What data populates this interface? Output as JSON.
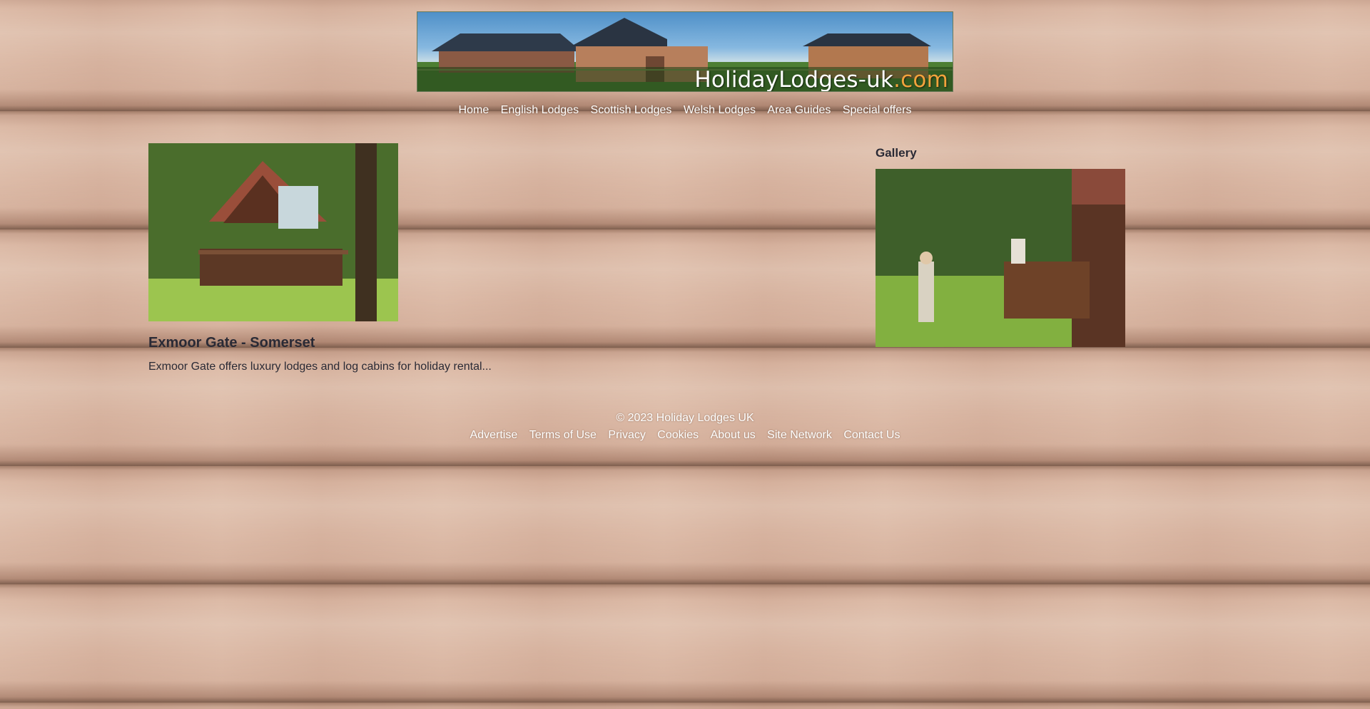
{
  "header": {
    "logo_text": "HolidayLodges-uk",
    "logo_tld": ".com"
  },
  "nav": {
    "items": [
      "Home",
      "English Lodges",
      "Scottish Lodges",
      "Welsh Lodges",
      "Area Guides",
      "Special offers"
    ]
  },
  "article": {
    "title": "Exmoor Gate - Somerset",
    "summary": "Exmoor Gate offers luxury lodges and log cabins for holiday rental..."
  },
  "sidebar": {
    "gallery_heading": "Gallery"
  },
  "footer": {
    "copyright": "© 2023 Holiday Lodges UK",
    "links": [
      "Advertise",
      "Terms of Use",
      "Privacy",
      "Cookies",
      "About us",
      "Site Network",
      "Contact Us"
    ]
  },
  "colors": {
    "tld_accent": "#f1a23c",
    "text_dark": "#2a2a35",
    "nav_text": "#ffffff"
  }
}
